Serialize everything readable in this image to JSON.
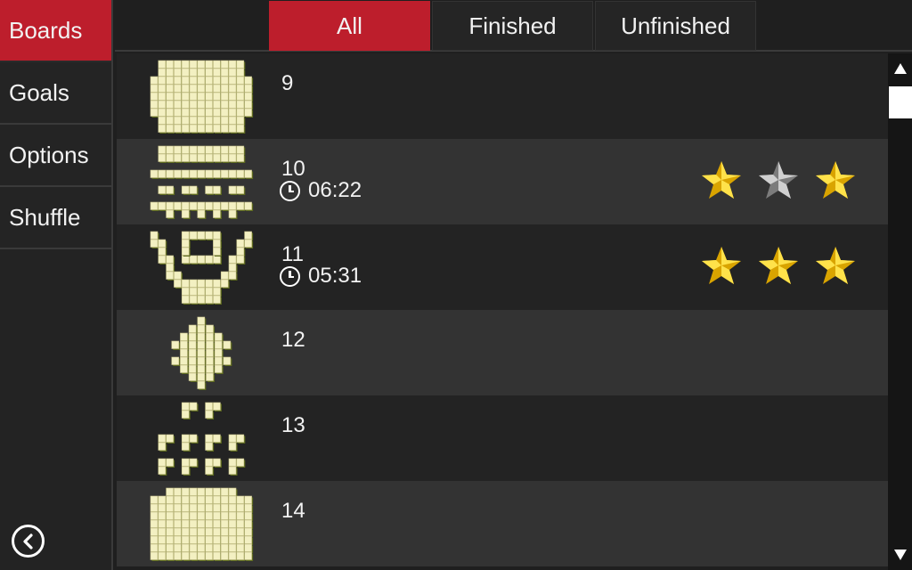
{
  "sidebar": {
    "items": [
      {
        "label": "Boards",
        "active": true
      },
      {
        "label": "Goals",
        "active": false
      },
      {
        "label": "Options",
        "active": false
      },
      {
        "label": "Shuffle",
        "active": false
      }
    ],
    "back_icon": "circle-chevron-left-icon"
  },
  "tabs": [
    {
      "label": "All",
      "active": true
    },
    {
      "label": "Finished",
      "active": false
    },
    {
      "label": "Unfinished",
      "active": false
    }
  ],
  "colors": {
    "accent": "#bd1e2c",
    "row_dark": "#232323",
    "row_light": "#333333",
    "star_gold": "#f5c518",
    "star_gray": "#9a9a9a",
    "tile": "#f3f0c2"
  },
  "boards": [
    {
      "number": "9",
      "time": null,
      "stars": null,
      "shape": "pyramid-wide"
    },
    {
      "number": "10",
      "time": "06:22",
      "stars": [
        true,
        false,
        true
      ],
      "shape": "bars"
    },
    {
      "number": "11",
      "time": "05:31",
      "stars": [
        true,
        true,
        true
      ],
      "shape": "cup"
    },
    {
      "number": "12",
      "time": null,
      "stars": null,
      "shape": "diamond"
    },
    {
      "number": "13",
      "time": null,
      "stars": null,
      "shape": "crosses"
    },
    {
      "number": "14",
      "time": null,
      "stars": null,
      "shape": "stack"
    }
  ],
  "scrollbar": {
    "position_fraction": 0.06,
    "up_icon": "triangle-up-icon",
    "down_icon": "triangle-down-icon"
  }
}
